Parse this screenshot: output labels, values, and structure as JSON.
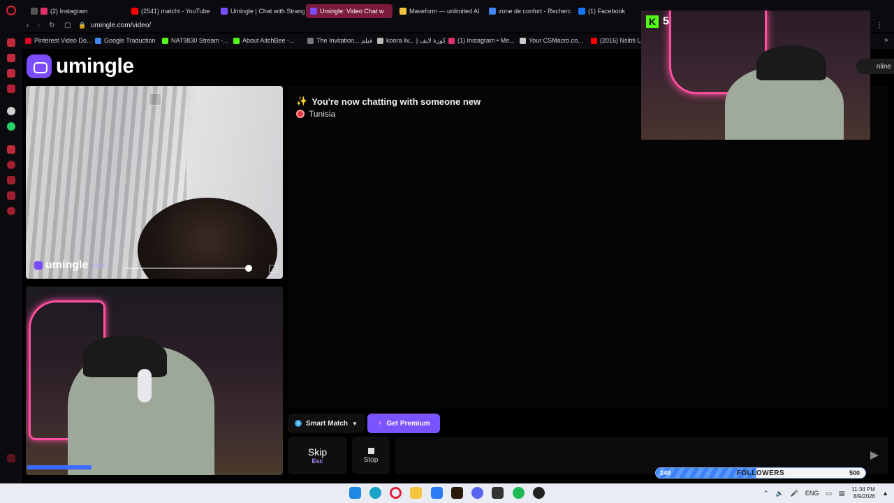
{
  "browser": {
    "tabs": [
      {
        "label": "(2) Instagram",
        "color": "#e1306c",
        "active": false
      },
      {
        "label": "(2541) matcht - YouTube",
        "color": "#ff0000",
        "active": false
      },
      {
        "label": "Umingle | Chat with Strang",
        "color": "#7c4dff",
        "active": false
      },
      {
        "label": "Umingle: Video Chat w",
        "color": "#7c4dff",
        "active": true
      },
      {
        "label": "Maveform — unlimited AI",
        "color": "#f5c542",
        "active": false
      },
      {
        "label": "zone de confort - Recherc",
        "color": "#4285f4",
        "active": false
      },
      {
        "label": "(1) Facebook",
        "color": "#1877f2",
        "active": false
      }
    ],
    "url": "umingle.com/video/",
    "bookmarks": [
      {
        "label": "Pinterest Video Do...",
        "color": "#e60023"
      },
      {
        "label": "Google Traduction",
        "color": "#4285f4"
      },
      {
        "label": "NAT9830 Stream -...",
        "color": "#53fc18"
      },
      {
        "label": "About AitchBee -...",
        "color": "#53fc18"
      },
      {
        "label": "The Invitation... فيلم",
        "color": "#777777"
      },
      {
        "label": "koora liv... | كورة لايف",
        "color": "#bbbbbb"
      },
      {
        "label": "(1) Instagram • Me...",
        "color": "#e1306c"
      },
      {
        "label": "Your CSMacro.co...",
        "color": "#cccccc"
      },
      {
        "label": "(2016) Nsibti La",
        "color": "#ff0000"
      }
    ]
  },
  "site": {
    "logo_text": "umingle",
    "watermark_text": "umingle",
    "watermark_sub": ".com"
  },
  "chat": {
    "status": "You're now chatting with someone new",
    "country": "Tunisia",
    "message_placeholder": ""
  },
  "controls": {
    "smart_match": "Smart Match",
    "get_premium": "Get Premium",
    "skip": "Skip",
    "skip_key": "Esc",
    "stop": "Stop"
  },
  "stream": {
    "kick_count": "5",
    "online_label": "nline",
    "followers": {
      "label": "FOLLOWERS",
      "current": 240,
      "goal": 500
    }
  },
  "taskbar": {
    "language": "ENG",
    "time": "11:34 PM",
    "date": "8/9/2026"
  },
  "colors": {
    "brand": "#7c4dff",
    "premium": "#7a55ff",
    "kick": "#53fc18"
  }
}
